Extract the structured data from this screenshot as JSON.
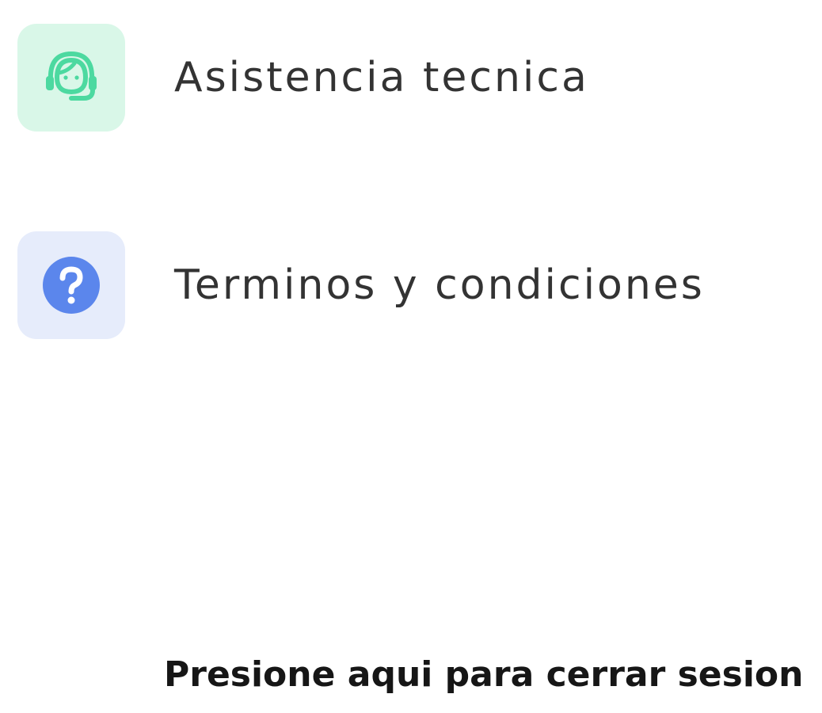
{
  "menu": {
    "items": [
      {
        "label": "Asistencia tecnica",
        "icon": "headset-support-icon",
        "icon_color": "#4cd9a0",
        "tile_color": "#d9f7e8"
      },
      {
        "label": "Terminos y condiciones",
        "icon": "question-circle-icon",
        "icon_color": "#5b86ec",
        "tile_color": "#e6ecfb"
      }
    ]
  },
  "logout": {
    "label": "Presione aqui para cerrar sesion"
  }
}
